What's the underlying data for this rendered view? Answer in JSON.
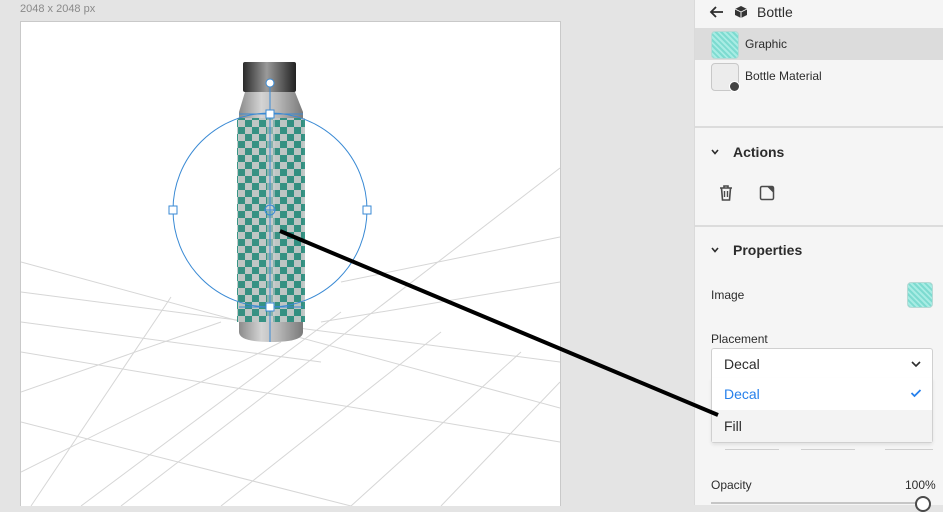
{
  "canvas": {
    "size_label": "2048 x 2048 px"
  },
  "layers": {
    "title": "Bottle",
    "items": [
      {
        "label": "Graphic",
        "thumb": "graphic-thumbnail"
      },
      {
        "label": "Bottle Material",
        "thumb": "material-thumbnail"
      }
    ]
  },
  "actions": {
    "title": "Actions",
    "buttons": [
      "trash-icon",
      "flip-icon"
    ]
  },
  "properties": {
    "title": "Properties",
    "image_label": "Image",
    "placement_label": "Placement",
    "placement_value": "Decal",
    "placement_options": [
      "Decal",
      "Fill"
    ],
    "opacity_label": "Opacity",
    "opacity_value": "100%",
    "opacity_fraction": 1.0
  },
  "colors": {
    "accent": "#2680eb",
    "teal": "#3a9a8a",
    "gizmo": "#3a8ad4"
  }
}
